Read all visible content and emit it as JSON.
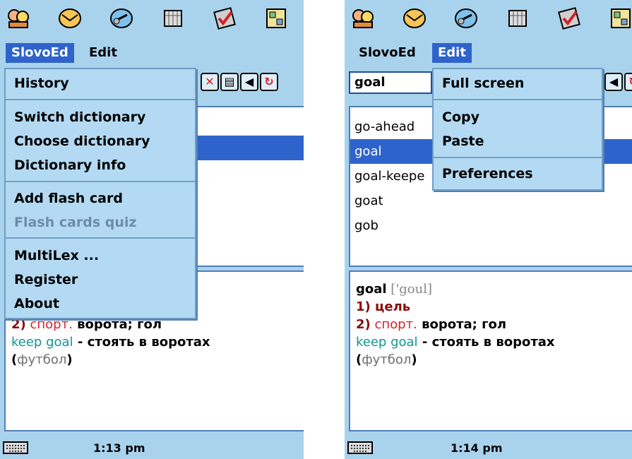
{
  "left": {
    "menubar": {
      "menu1": "SlovoEd",
      "menu2": "Edit"
    },
    "menu": {
      "items": [
        "History",
        "Switch dictionary",
        "Choose dictionary",
        "Dictionary info",
        "Add flash card",
        "Flash cards quiz",
        "MultiLex ...",
        "Register",
        "About"
      ],
      "disabled_item": "Flash cards quiz"
    },
    "article": {
      "sense2_num": "2)",
      "sense2_mark": "спорт.",
      "sense2_text": " ворота; гол",
      "phrase": "keep goal",
      "phrase_dash": " - стоять в воротах",
      "paren_open": "(",
      "paren_text": "футбол",
      "paren_close": ")"
    },
    "status": {
      "time": "1:13 pm"
    }
  },
  "right": {
    "menubar": {
      "menu1": "SlovoEd",
      "menu2": "Edit"
    },
    "search": {
      "value": "goal"
    },
    "wordlist": [
      "go-ahead",
      "goal",
      "goal-keepe",
      "goat",
      "gob"
    ],
    "selected_word": "goal",
    "menu": {
      "items": [
        "Full screen",
        "Copy",
        "Paste",
        "Preferences"
      ]
    },
    "article": {
      "headword": "goal",
      "transcription": " ['goul]",
      "sense1": "1) цель",
      "sense2_num": "2)",
      "sense2_mark": "спорт.",
      "sense2_text": " ворота; гол",
      "phrase": "keep goal",
      "phrase_dash": " - стоять в воротах",
      "paren_open": "(",
      "paren_text": "футбол",
      "paren_close": ")"
    },
    "status": {
      "time": "1:14 pm"
    }
  },
  "icons": [
    "people-icon",
    "envelope-icon",
    "link-icon",
    "calendar-icon",
    "checkmark-icon",
    "settings-grid-icon"
  ],
  "colors": {
    "background": "#a9d3ec",
    "menu_highlight": "#2f63cc",
    "number_color": "#8b0b0b",
    "phrase_color": "#129497"
  }
}
